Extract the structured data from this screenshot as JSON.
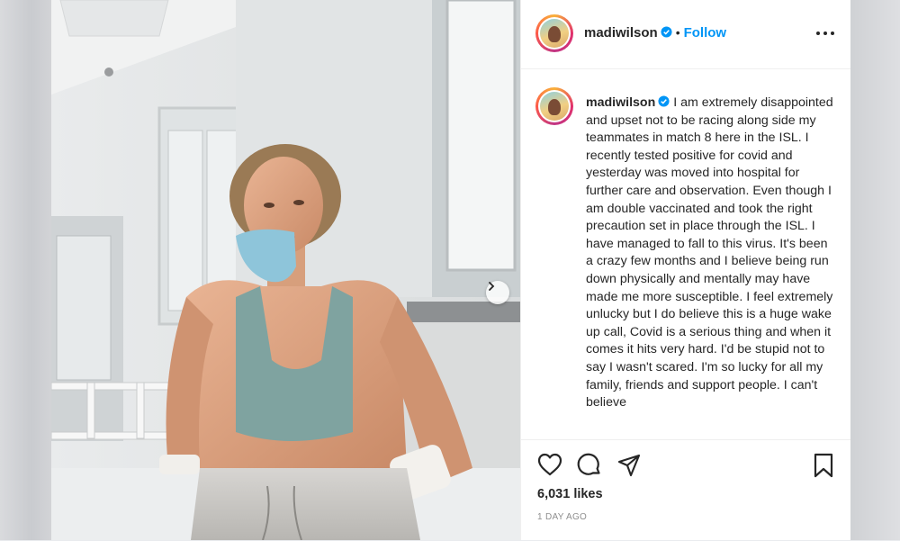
{
  "post": {
    "username": "madiwilson",
    "follow_label": "Follow",
    "separator": "•",
    "caption": "I am extremely disappointed and upset not to be racing along side my teammates in match 8 here in the ISL. I recently tested positive for covid and yesterday was moved into hospital for further care and observation. Even though I am double vaccinated and took the right precaution set in place through the ISL. I have managed to fall to this virus. It's been a crazy few months and I believe being run down physically and mentally may have made me more susceptible. I feel extremely unlucky but I do believe this is a huge wake up call, Covid is a serious thing and when it comes it hits very hard. I'd be stupid not to say I wasn't scared. I'm so lucky for all my family, friends and support people. I can't believe",
    "likes": "6,031 likes",
    "timestamp": "1 DAY AGO"
  },
  "icons": {
    "verified": "verified-badge-icon",
    "more": "more-options-icon",
    "like": "heart-icon",
    "comment": "comment-icon",
    "share": "paper-plane-icon",
    "save": "bookmark-icon",
    "next": "chevron-right-icon"
  },
  "colors": {
    "accent": "#0095f6",
    "text": "#262626",
    "muted": "#8e8e8e",
    "border": "#efefef"
  }
}
